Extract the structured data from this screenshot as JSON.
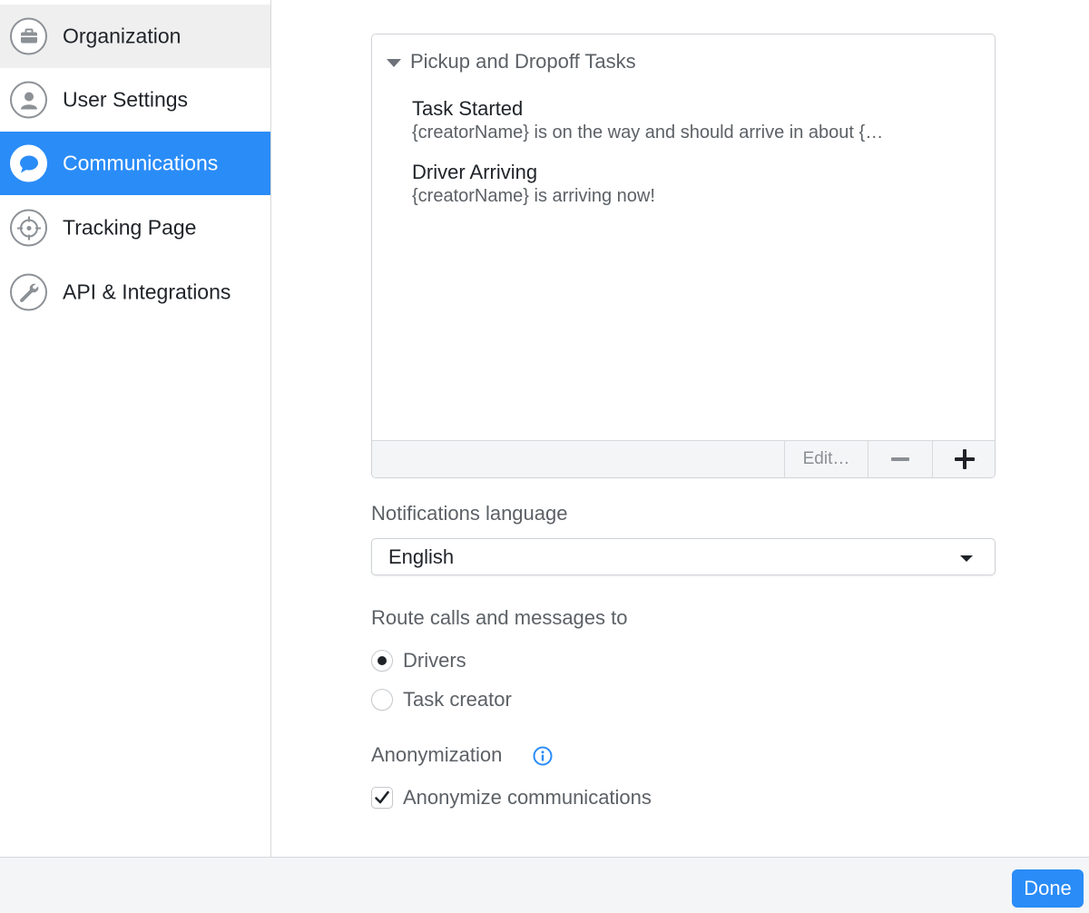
{
  "sidebar": {
    "items": [
      {
        "label": "Organization",
        "icon": "briefcase-icon"
      },
      {
        "label": "User Settings",
        "icon": "user-icon"
      },
      {
        "label": "Communications",
        "icon": "chat-bubble-icon"
      },
      {
        "label": "Tracking Page",
        "icon": "crosshair-icon"
      },
      {
        "label": "API & Integrations",
        "icon": "wrench-icon"
      }
    ],
    "hovered_index": 0,
    "active_index": 2
  },
  "tasks": {
    "group_label": "Pickup and Dropoff Tasks",
    "items": [
      {
        "title": "Task Started",
        "message": "{creatorName} is on the way and should arrive in about {…"
      },
      {
        "title": "Driver Arriving",
        "message": "{creatorName} is arriving now!"
      }
    ],
    "edit_label": "Edit…",
    "remove_icon": "minus-icon",
    "add_icon": "plus-icon"
  },
  "language": {
    "label": "Notifications language",
    "selected": "English"
  },
  "routing": {
    "label": "Route calls and messages to",
    "options": [
      {
        "label": "Drivers",
        "selected": true
      },
      {
        "label": "Task creator",
        "selected": false
      }
    ]
  },
  "anonymization": {
    "label": "Anonymization",
    "checkbox_label": "Anonymize communications",
    "checked": true
  },
  "footer": {
    "done_label": "Done"
  },
  "colors": {
    "accent": "#2a8cf7",
    "info": "#2a8cf7"
  }
}
